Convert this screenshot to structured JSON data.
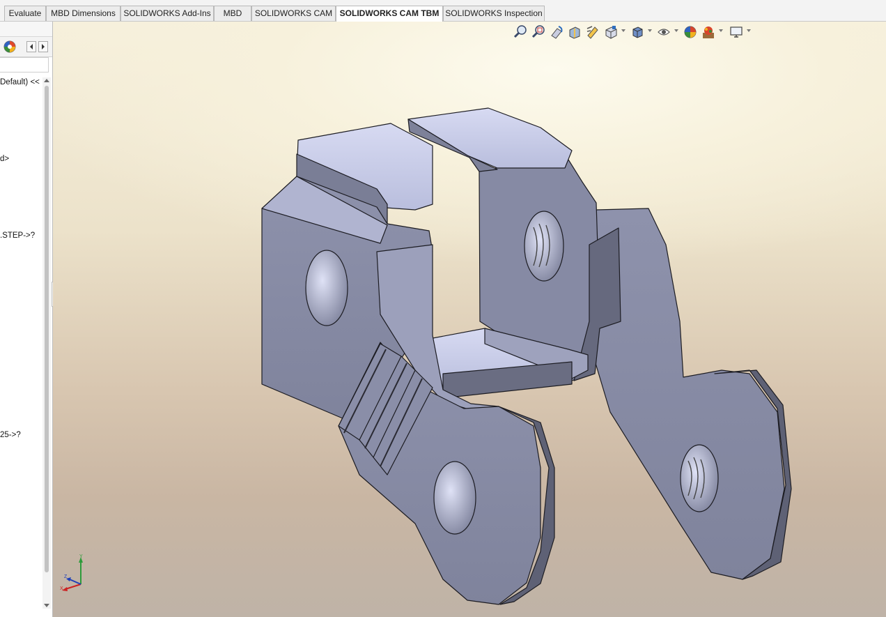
{
  "tabs": [
    {
      "label": "Evaluate",
      "active": false
    },
    {
      "label": "MBD Dimensions",
      "active": false
    },
    {
      "label": "SOLIDWORKS Add-Ins",
      "active": false
    },
    {
      "label": "MBD",
      "active": false
    },
    {
      "label": "SOLIDWORKS CAM",
      "active": false
    },
    {
      "label": "SOLIDWORKS CAM TBM",
      "active": true
    },
    {
      "label": "SOLIDWORKS Inspection",
      "active": false
    }
  ],
  "feature_tree": {
    "lines": [
      "Default) <<",
      "d>",
      ".STEP->?",
      "25->?"
    ]
  },
  "heads_up_toolbar": [
    "zoom-to-fit-icon",
    "zoom-to-area-icon",
    "previous-view-icon",
    "section-view-icon",
    "dynamic-annotation-icon",
    "view-orientation-icon",
    "display-style-icon",
    "hide-show-icon",
    "edit-appearance-icon",
    "apply-scene-icon",
    "view-settings-icon"
  ],
  "colors": {
    "part_light": "#c7cbe6",
    "part_mid": "#8a8ea8",
    "part_dark": "#5c5f73",
    "active_tab": "#ffffff"
  }
}
